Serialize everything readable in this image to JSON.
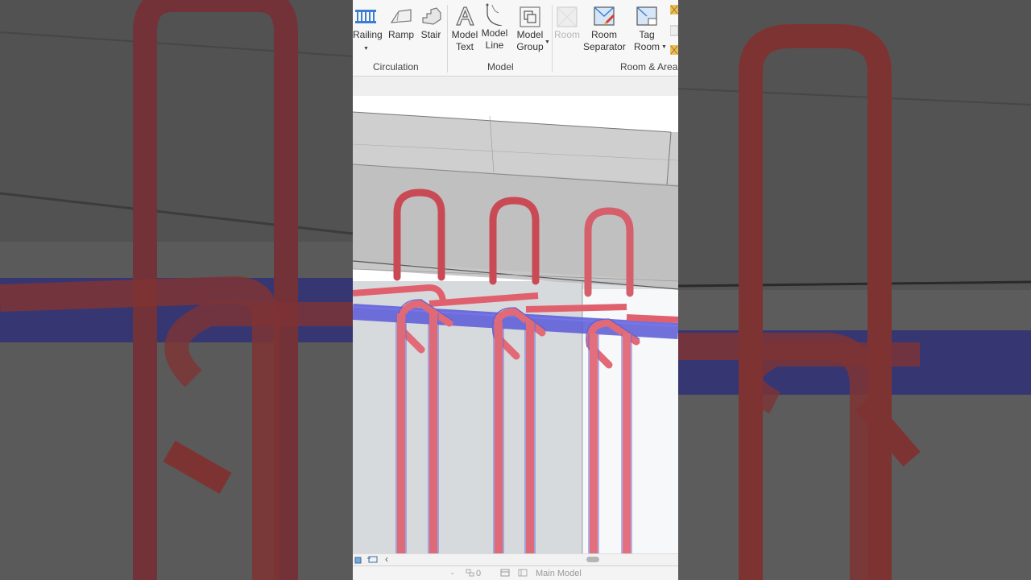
{
  "ribbon": {
    "tools": [
      {
        "id": "railing",
        "line1": "Railing",
        "line2": ""
      },
      {
        "id": "ramp",
        "line1": "Ramp",
        "line2": ""
      },
      {
        "id": "stair",
        "line1": "Stair",
        "line2": ""
      },
      {
        "id": "model-text",
        "line1": "Model",
        "line2": "Text"
      },
      {
        "id": "model-line",
        "line1": "Model",
        "line2": "Line"
      },
      {
        "id": "model-group",
        "line1": "Model",
        "line2": "Group"
      },
      {
        "id": "room",
        "line1": "Room",
        "line2": ""
      },
      {
        "id": "room-separator",
        "line1": "Room",
        "line2": "Separator"
      },
      {
        "id": "tag-room",
        "line1": "Tag",
        "line2": "Room"
      }
    ],
    "panels": {
      "circulation": "Circulation",
      "model": "Model",
      "room_area": "Room & Area"
    }
  },
  "statusbar": {
    "scale_text": "0",
    "model_name": "Main Model"
  },
  "colors": {
    "rebar_red": "#d9505e",
    "rebar_blue": "#5d5de0",
    "concrete": "#c8c8c8",
    "ribbon_bg": "#f7f7f7"
  }
}
